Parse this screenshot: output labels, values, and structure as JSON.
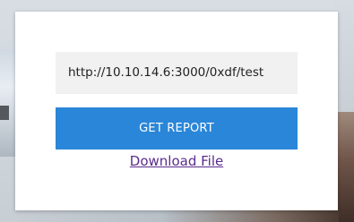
{
  "form": {
    "url_value": "http://10.10.14.6:3000/0xdf/test",
    "submit_label": "GET REPORT",
    "download_label": "Download File"
  },
  "colors": {
    "button_bg": "#2a86d8",
    "link_visited": "#5b2c8c",
    "input_bg": "#f1f1f1"
  }
}
